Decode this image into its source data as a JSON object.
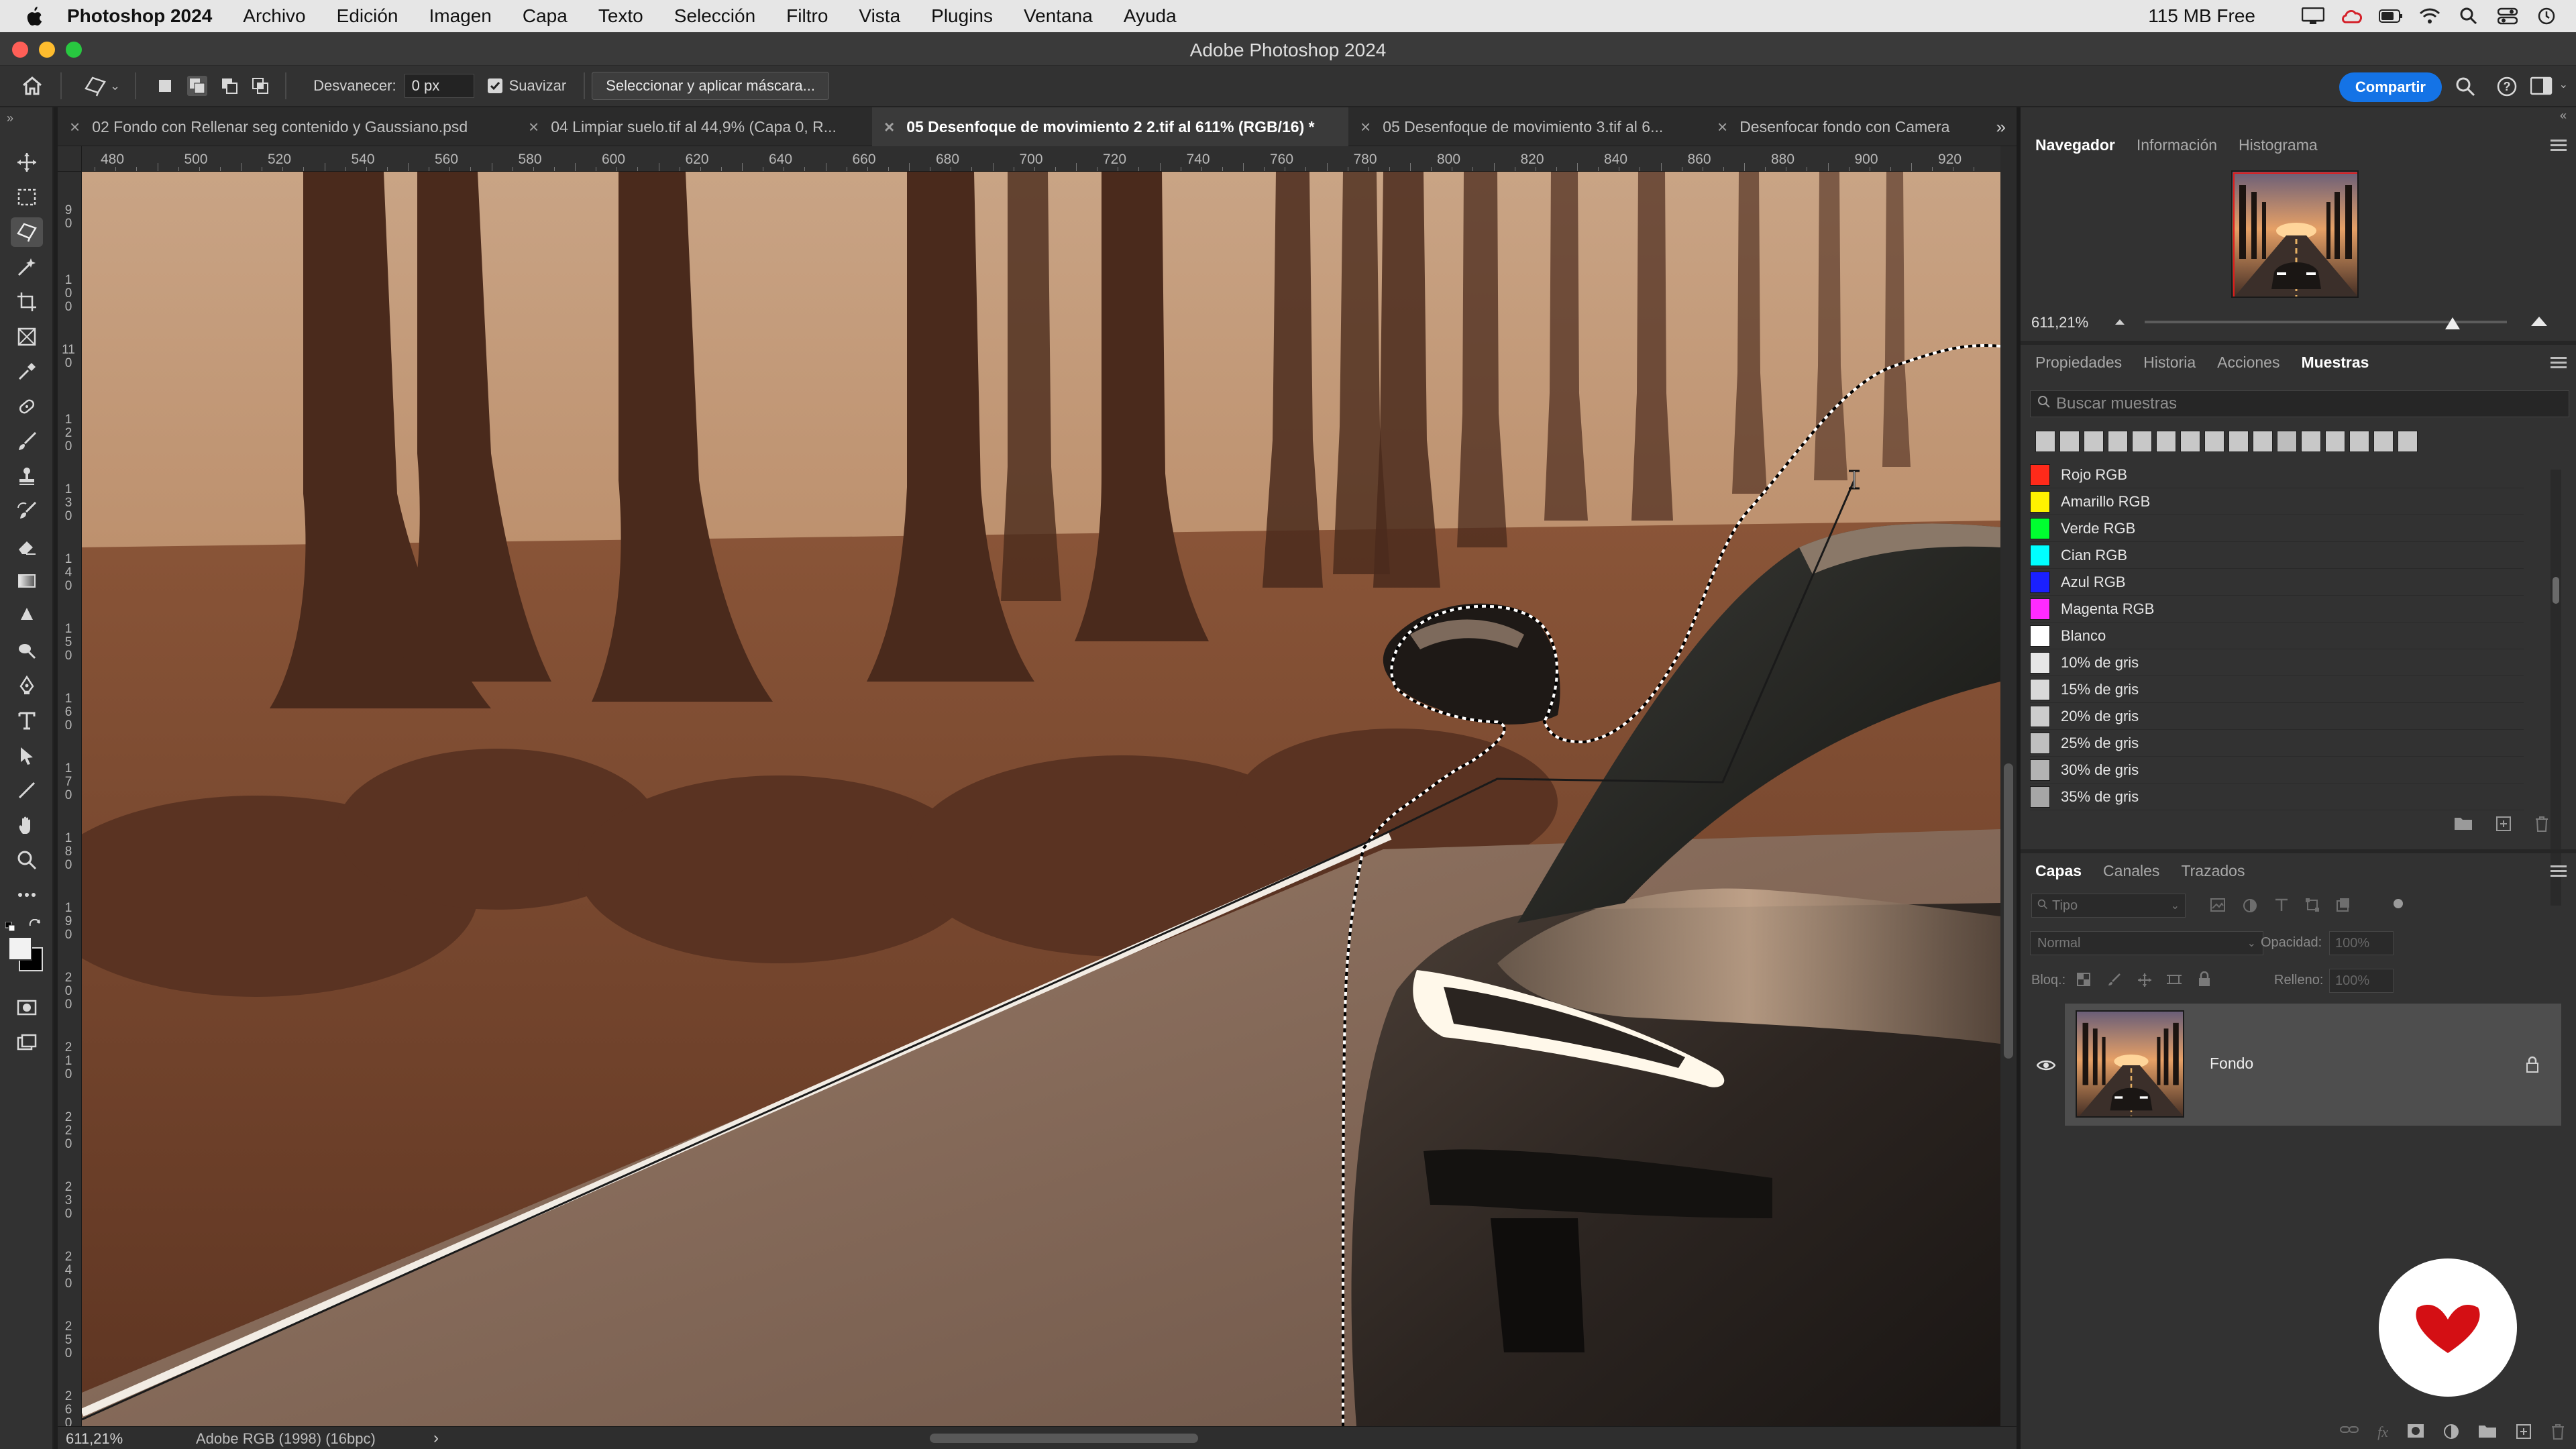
{
  "menubar": {
    "app_name": "Photoshop 2024",
    "items": [
      "Archivo",
      "Edición",
      "Imagen",
      "Capa",
      "Texto",
      "Selección",
      "Filtro",
      "Vista",
      "Plugins",
      "Ventana",
      "Ayuda"
    ],
    "memory": "115 MB Free"
  },
  "window": {
    "title": "Adobe Photoshop 2024"
  },
  "options_bar": {
    "feather_label": "Desvanecer:",
    "feather_value": "0 px",
    "smooth_label": "Suavizar",
    "smooth_checked": true,
    "mask_button": "Seleccionar y aplicar máscara...",
    "share_button": "Compartir"
  },
  "tabs": [
    {
      "label": "02 Fondo con Rellenar seg contenido y Gaussiano.psd",
      "active": false
    },
    {
      "label": "04 Limpiar suelo.tif al 44,9% (Capa 0, R...",
      "active": false
    },
    {
      "label": "05 Desenfoque de movimiento 2 2.tif al 611% (RGB/16) *",
      "active": true
    },
    {
      "label": "05 Desenfoque de movimiento 3.tif al 6...",
      "active": false
    },
    {
      "label": "Desenfocar fondo con Camera",
      "active": false
    }
  ],
  "ruler": {
    "top_labels": [
      "480",
      "500",
      "520",
      "540",
      "560",
      "580",
      "600",
      "620",
      "640",
      "660",
      "680",
      "700",
      "720",
      "740",
      "760",
      "780",
      "800",
      "820",
      "840",
      "860",
      "880",
      "900",
      "920"
    ],
    "left_labels": [
      "90",
      "100",
      "110",
      "120",
      "130",
      "140",
      "150",
      "160",
      "170",
      "180",
      "190",
      "200",
      "210",
      "220",
      "230",
      "240",
      "250",
      "260"
    ]
  },
  "status_bar": {
    "zoom": "611,21%",
    "profile": "Adobe RGB (1998) (16bpc)",
    "arrow": "›"
  },
  "navigator": {
    "tabs": [
      "Navegador",
      "Información",
      "Histograma"
    ],
    "active_tab": "Navegador",
    "zoom": "611,21%",
    "zoom_fraction": 0.85
  },
  "swatches_panel": {
    "tabs": [
      "Propiedades",
      "Historia",
      "Acciones",
      "Muestras"
    ],
    "active_tab": "Muestras",
    "search_placeholder": "Buscar muestras",
    "recent_colors": [
      "#c8c8c8",
      "#c8c8c8",
      "#c8c8c8",
      "#c8c8c8",
      "#c8c8c8",
      "#c8c8c8",
      "#c8c8c8",
      "#c8c8c8",
      "#c8c8c8",
      "#c8c8c8",
      "#bdbdbd",
      "#c8c8c8",
      "#c8c8c8",
      "#c8c8c8",
      "#c8c8c8",
      "#c8c8c8"
    ],
    "items": [
      {
        "name": "Rojo RGB",
        "color": "#ff2a1a"
      },
      {
        "name": "Amarillo RGB",
        "color": "#fff200"
      },
      {
        "name": "Verde RGB",
        "color": "#00ff30"
      },
      {
        "name": "Cian RGB",
        "color": "#00ffff"
      },
      {
        "name": "Azul RGB",
        "color": "#1a20ff"
      },
      {
        "name": "Magenta RGB",
        "color": "#ff2aff"
      },
      {
        "name": "Blanco",
        "color": "#ffffff"
      },
      {
        "name": "10% de gris",
        "color": "#e6e6e6"
      },
      {
        "name": "15% de gris",
        "color": "#d9d9d9"
      },
      {
        "name": "20% de gris",
        "color": "#cccccc"
      },
      {
        "name": "25% de gris",
        "color": "#bfbfbf"
      },
      {
        "name": "30% de gris",
        "color": "#b3b3b3"
      },
      {
        "name": "35% de gris",
        "color": "#a6a6a6"
      }
    ]
  },
  "layers_panel": {
    "tabs": [
      "Capas",
      "Canales",
      "Trazados"
    ],
    "active_tab": "Capas",
    "filter_placeholder": "Tipo",
    "blend_mode": "Normal",
    "opacity_label": "Opacidad:",
    "opacity_value": "100%",
    "lock_label": "Bloq.:",
    "fill_label": "Relleno:",
    "fill_value": "100%",
    "layers": [
      {
        "name": "Fondo",
        "visible": true,
        "locked": true
      }
    ]
  },
  "colors": {
    "accent": "#1473e6",
    "logo": "#d40f14"
  }
}
